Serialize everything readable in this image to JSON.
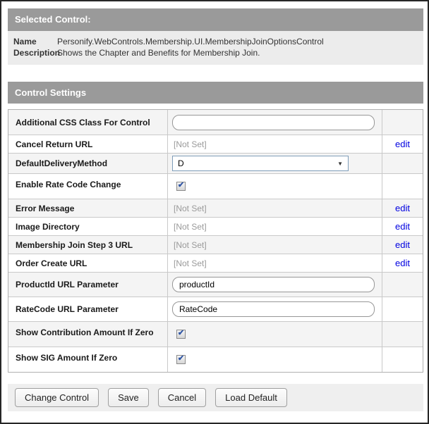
{
  "selected_control": {
    "title": "Selected Control:",
    "name_label": "Name",
    "name_value": "Personify.WebControls.Membership.UI.MembershipJoinOptionsControl",
    "description_label": "Description",
    "description_value": "Shows the Chapter and Benefits for Membership Join."
  },
  "control_settings": {
    "title": "Control Settings",
    "rows": [
      {
        "label": "Additional CSS Class For Control",
        "type": "text",
        "value": "",
        "action": ""
      },
      {
        "label": "Cancel Return URL",
        "type": "readonly",
        "value": "[Not Set]",
        "action": "edit"
      },
      {
        "label": "DefaultDeliveryMethod",
        "type": "select",
        "value": "D",
        "action": ""
      },
      {
        "label": "Enable Rate Code Change",
        "type": "checkbox",
        "checked": true,
        "action": ""
      },
      {
        "label": "Error Message",
        "type": "readonly",
        "value": "[Not Set]",
        "action": "edit"
      },
      {
        "label": "Image Directory",
        "type": "readonly",
        "value": "[Not Set]",
        "action": "edit"
      },
      {
        "label": "Membership Join Step 3 URL",
        "type": "readonly",
        "value": "[Not Set]",
        "action": "edit"
      },
      {
        "label": "Order Create URL",
        "type": "readonly",
        "value": "[Not Set]",
        "action": "edit"
      },
      {
        "label": "ProductId URL Parameter",
        "type": "text",
        "value": "productId",
        "action": ""
      },
      {
        "label": "RateCode URL Parameter",
        "type": "text",
        "value": "RateCode",
        "action": ""
      },
      {
        "label": "Show Contribution Amount If Zero",
        "type": "checkbox",
        "checked": true,
        "action": ""
      },
      {
        "label": "Show SIG Amount If Zero",
        "type": "checkbox",
        "checked": true,
        "action": ""
      }
    ]
  },
  "buttons": [
    {
      "label": "Change Control"
    },
    {
      "label": "Save"
    },
    {
      "label": "Cancel"
    },
    {
      "label": "Load Default"
    }
  ],
  "icons": {
    "dropdown_arrow": "▼",
    "checkmark": "✔"
  },
  "colors": {
    "header_gray": "#9a9a9a",
    "info_background": "#ececec",
    "row_alt_gray": "#f4f4f4",
    "link_blue": "#0000e0",
    "notset_gray": "#9a9a9a",
    "checkmark_blue": "#2f55a4",
    "select_border": "#7f9db9"
  }
}
